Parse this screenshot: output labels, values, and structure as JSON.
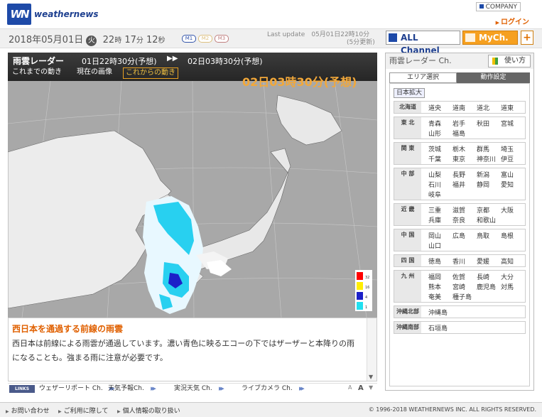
{
  "header": {
    "logo": "WN",
    "brand": "weathernews",
    "company": "COMPANY",
    "login": "ログイン"
  },
  "datebar": {
    "year": "2018",
    "y_u": "年",
    "month": "05",
    "mo_u": "月",
    "day": "01",
    "d_u": "日",
    "dow": "火",
    "hour": "22",
    "h_u": "時",
    "min": "17",
    "mi_u": "分",
    "sec": "12",
    "s_u": "秒",
    "modes": [
      "M1",
      "M2",
      "M3"
    ],
    "last_update": "Last update　05月01日22時10分",
    "interval": "(5分更新)"
  },
  "nav": {
    "all_channel": "ALL Channel",
    "mych": "MyCh.",
    "plus": "+"
  },
  "radar": {
    "title": "雨雲レーダー",
    "from": "01日22時30分(予想)",
    "arrow": "▶▶",
    "to": "02日03時30分(予想)",
    "tabs": [
      "これまでの動き",
      "現在の画像",
      "これからの動き"
    ],
    "forecast_time": "02日03時30分(予想)",
    "legend": [
      "32",
      "16",
      "4",
      "1"
    ],
    "legend_colors": [
      "#ff0000",
      "#ffee00",
      "#1c20c8",
      "#20e0f0"
    ]
  },
  "description": {
    "title": "西日本を通過する前線の雨雲",
    "body": "西日本は前線による雨雲が通過しています。濃い青色に映るエコーの下ではザーザーと本降りの雨になることも。強まる雨に注意が必要です。"
  },
  "links": {
    "tag": "LINKS",
    "items": [
      "ウェザーリポート Ch.",
      "天気予報Ch.",
      "実況天気 Ch.",
      "ライブカメラ Ch."
    ],
    "font_small": "A",
    "font_large": "A",
    "scroll": "▼"
  },
  "sidebar": {
    "title": "雨雲レーダー Ch.",
    "usage": "使い方",
    "tab_area": "エリア選択",
    "tab_motion": "動作設定",
    "zoom": "日本拡大",
    "regions": [
      {
        "label": "北海道",
        "prefs": [
          "道央",
          "道南",
          "道北",
          "道東"
        ]
      },
      {
        "label": "東 北",
        "prefs": [
          "青森",
          "岩手",
          "秋田",
          "宮城",
          "山形",
          "福島"
        ]
      },
      {
        "label": "関 東",
        "prefs": [
          "茨城",
          "栃木",
          "群馬",
          "埼玉",
          "千葉",
          "東京",
          "神奈川",
          "伊豆"
        ]
      },
      {
        "label": "中 部",
        "prefs": [
          "山梨",
          "長野",
          "新潟",
          "富山",
          "石川",
          "福井",
          "静岡",
          "愛知",
          "岐阜"
        ]
      },
      {
        "label": "近 畿",
        "prefs": [
          "三重",
          "滋賀",
          "京都",
          "大阪",
          "兵庫",
          "奈良",
          "和歌山"
        ]
      },
      {
        "label": "中 国",
        "prefs": [
          "岡山",
          "広島",
          "鳥取",
          "島根",
          "山口"
        ]
      },
      {
        "label": "四 国",
        "prefs": [
          "徳島",
          "香川",
          "愛媛",
          "高知"
        ]
      },
      {
        "label": "九 州",
        "prefs": [
          "福岡",
          "佐賀",
          "長崎",
          "大分",
          "熊本",
          "宮崎",
          "鹿児島",
          "対馬",
          "奄美",
          "種子島"
        ]
      },
      {
        "label": "沖縄北部",
        "prefs": [
          "沖縄島"
        ]
      },
      {
        "label": "沖縄南部",
        "prefs": [
          "石垣島"
        ]
      }
    ]
  },
  "footer": {
    "inquiry": "お問い合わせ",
    "terms": "ご利用に際して",
    "privacy": "個人情報の取り扱い",
    "copyright": "© 1996-2018 WEATHERNEWS INC. ALL RIGHTS RESERVED."
  }
}
